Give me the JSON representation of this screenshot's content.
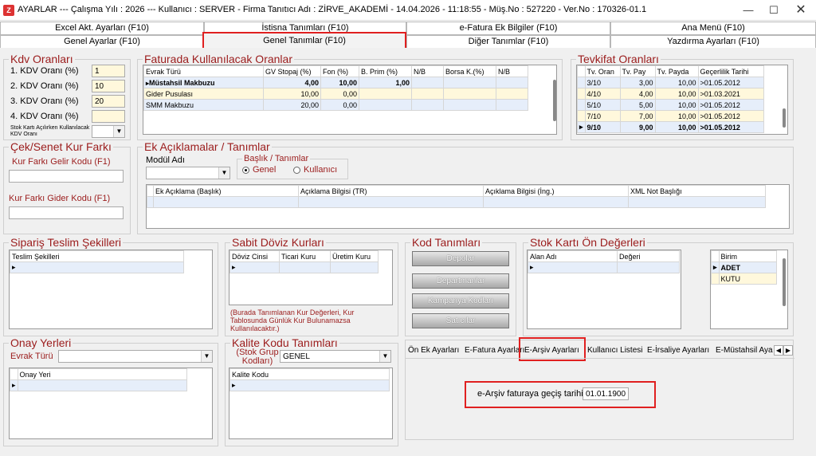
{
  "window": {
    "title": "AYARLAR  ---  Çalışma Yılı : 2026  ---  Kullanıcı : SERVER - Firma Tanıtıcı Adı : ZİRVE_AKADEMİ - 14.04.2026 - 11:18:55 - Müş.No : 527220 - Ver.No : 170326-01.1",
    "minimize": "—",
    "maximize": "☐",
    "close": "✕"
  },
  "tabs_row1": [
    "Excel Akt. Ayarları (F10)",
    "İstisna Tanımları (F10)",
    "e-Fatura Ek Bilgiler (F10)",
    "Ana Menü (F10)"
  ],
  "tabs_row2": [
    "Genel Ayarlar (F10)",
    "Genel Tanımlar (F10)",
    "Diğer Tanımlar (F10)",
    "Yazdırma Ayarları (F10)"
  ],
  "kdv": {
    "title": "Kdv Oranları",
    "labels": [
      "1. KDV Oranı (%)",
      "2. KDV Oranı (%)",
      "3. KDV Oranı (%)",
      "4. KDV Oranı (%)"
    ],
    "values": [
      "1",
      "10",
      "20",
      ""
    ],
    "stok_label": "Stok Kartı Açılırken Kullanılacak KDV Oranı",
    "stok_value": ""
  },
  "faturada": {
    "title": "Faturada Kullanılacak Oranlar",
    "headers": [
      "Evrak Türü",
      "GV Stopaj (%)",
      "Fon (%)",
      "B. Prim (%)",
      "N/B",
      "Borsa K.(%)",
      "N/B"
    ],
    "rows": [
      [
        "Müstahsil Makbuzu",
        "4,00",
        "10,00",
        "1,00",
        "",
        "",
        ""
      ],
      [
        "Gider Pusulası",
        "10,00",
        "0,00",
        "",
        "",
        "",
        ""
      ],
      [
        "SMM Makbuzu",
        "20,00",
        "0,00",
        "",
        "",
        "",
        ""
      ]
    ]
  },
  "tevkifat": {
    "title": "Tevkifat Oranları",
    "headers": [
      "Tv. Oran",
      "Tv. Pay",
      "Tv. Payda",
      "Geçerlilik Tarihi"
    ],
    "rows": [
      [
        "3/10",
        "3,00",
        "10,00",
        ">01.05.2012"
      ],
      [
        "4/10",
        "4,00",
        "10,00",
        ">01.03.2021"
      ],
      [
        "5/10",
        "5,00",
        "10,00",
        ">01.05.2012"
      ],
      [
        "7/10",
        "7,00",
        "10,00",
        ">01.05.2012"
      ],
      [
        "9/10",
        "9,00",
        "10,00",
        ">01.05.2012"
      ]
    ]
  },
  "cek_senet": {
    "title": "Çek/Senet Kur Farkı",
    "gelir_label": "Kur Farkı Gelir Kodu (F1)",
    "gelir_value": "",
    "gider_label": "Kur Farkı Gider Kodu (F1)",
    "gider_value": ""
  },
  "ek_aciklama": {
    "title": "Ek Açıklamalar / Tanımlar",
    "modul_label": "Modül Adı",
    "modul_value": "",
    "baslik_label": "Başlık / Tanımlar",
    "radio_genel": "Genel",
    "radio_kullanici": "Kullanıcı",
    "headers": [
      "Ek Açıklama (Başlık)",
      "Açıklama Bilgisi (TR)",
      "Açıklama Bilgisi (İng.)",
      "XML Not Başlığı"
    ]
  },
  "siparis": {
    "title": "Sipariş Teslim Şekilleri",
    "headers": [
      "Teslim Şekilleri"
    ]
  },
  "doviz": {
    "title": "Sabit Döviz Kurları",
    "headers": [
      "Döviz Cinsi",
      "Ticari Kuru",
      "Üretim Kuru"
    ],
    "note": "(Burada Tanımlanan Kur Değerleri, Kur Tablosunda Günlük Kur Bulunamazsa Kullanılacaktır.)"
  },
  "kod": {
    "title": "Kod Tanımları",
    "buttons": [
      "Depolar",
      "Departmanlar",
      "Kampanya Kodları",
      "Satıcılar"
    ]
  },
  "stok_onde": {
    "title": "Stok Kartı Ön Değerleri",
    "headers": [
      "Alan Adı",
      "Değeri"
    ],
    "birim_header": "Birim",
    "birim_rows": [
      "ADET",
      "KUTU"
    ]
  },
  "onay": {
    "title": "Onay Yerleri",
    "evrak_label": "Evrak Türü",
    "evrak_value": "",
    "headers": [
      "Onay Yeri"
    ]
  },
  "kalite": {
    "title": "Kalite Kodu Tanımları",
    "grup_label": "(Stok Grup Kodları)",
    "grup_value": "GENEL",
    "headers": [
      "Kalite Kodu"
    ]
  },
  "subtabs": {
    "items": [
      "Ön Ek Ayarları",
      "E-Fatura Ayarları",
      "E-Arşiv Ayarları",
      "Kullanıcı Listesi",
      "E-İrsaliye Ayarları",
      "E-Müstahsil Aya"
    ],
    "left_arrow": "◀",
    "right_arrow": "▶"
  },
  "earsiv": {
    "label": "e-Arşiv faturaya geçiş tarihi :",
    "value": "01.01.1900"
  }
}
